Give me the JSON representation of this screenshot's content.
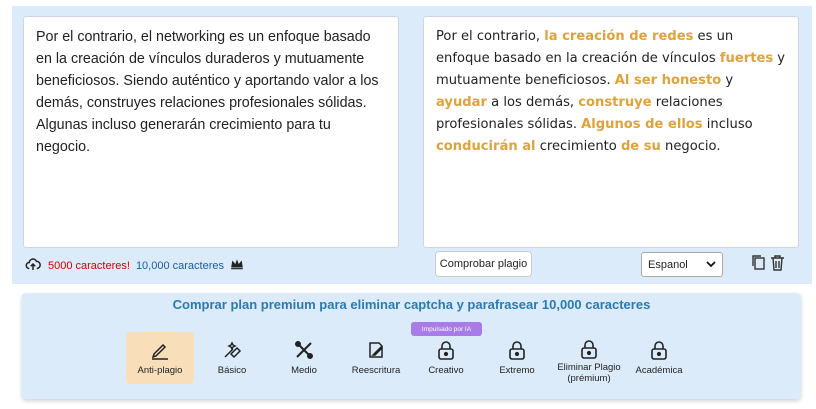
{
  "editor": {
    "input_text": "Por el contrario, el networking es un enfoque basado en la creación de vínculos duraderos y mutuamente beneficiosos. Siendo auténtico y aportando valor a los demás, construyes relaciones profesionales sólidas. Algunas incluso generarán crecimiento para tu negocio.",
    "output_segments": [
      {
        "text": "Por el contrario, ",
        "changed": false
      },
      {
        "text": "la creación de redes",
        "changed": true
      },
      {
        "text": " es un enfoque basado en la creación de vínculos ",
        "changed": false
      },
      {
        "text": "fuertes",
        "changed": true
      },
      {
        "text": " y mutuamente beneficiosos. ",
        "changed": false
      },
      {
        "text": "Al ser honesto",
        "changed": true
      },
      {
        "text": " y ",
        "changed": false
      },
      {
        "text": "ayudar",
        "changed": true
      },
      {
        "text": " a los demás, ",
        "changed": false
      },
      {
        "text": "construye",
        "changed": true
      },
      {
        "text": " relaciones profesionales sólidas. ",
        "changed": false
      },
      {
        "text": "Algunos de ellos",
        "changed": true
      },
      {
        "text": " incluso ",
        "changed": false
      },
      {
        "text": "conducirán al",
        "changed": true
      },
      {
        "text": " crecimiento ",
        "changed": false
      },
      {
        "text": "de su",
        "changed": true
      },
      {
        "text": " negocio.",
        "changed": false
      }
    ],
    "char_count": "5000 caracteres!",
    "char_limit": "10,000 caracteres",
    "check_plagiarism_label": "Comprobar plagio",
    "language_selected": "Espanol"
  },
  "premium": {
    "title": "Comprar plan premium para eliminar captcha y parafrasear 10,000 caracteres",
    "ai_badge": "Impulsado por IA",
    "modes": [
      {
        "label": "Anti-plagio",
        "icon": "pen-icon",
        "active": true
      },
      {
        "label": "Básico",
        "icon": "magic-icon",
        "active": false
      },
      {
        "label": "Medio",
        "icon": "tools-icon",
        "active": false
      },
      {
        "label": "Reescritura",
        "icon": "edit-icon",
        "active": false
      },
      {
        "label": "Creativo",
        "icon": "lock-icon",
        "active": false
      },
      {
        "label": "Extremo",
        "icon": "lock-icon",
        "active": false
      },
      {
        "label": "Eliminar Plagio (prémium)",
        "icon": "lock-icon",
        "active": false
      },
      {
        "label": "Académica",
        "icon": "lock-icon",
        "active": false
      }
    ]
  },
  "colors": {
    "highlight": "#e0a23a",
    "accent": "#2a7ab5",
    "panel_bg": "#dcebfa",
    "badge": "#a97be8",
    "count_red": "#d40000"
  }
}
